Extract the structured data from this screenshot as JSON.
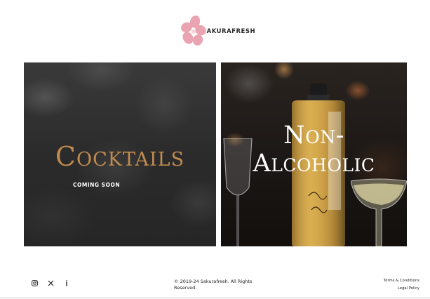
{
  "header": {
    "brand": "SAKURAFRESH",
    "brand_color": "#eaa3b0"
  },
  "panels": {
    "cocktails": {
      "title": "Cocktails",
      "subtitle": "COMING SOON",
      "title_color": "#c08b4e"
    },
    "non_alcoholic": {
      "title_line1": "Non-",
      "title_line2": "Alcoholic"
    }
  },
  "footer": {
    "social": [
      {
        "name": "instagram-icon",
        "glyph": "◎"
      },
      {
        "name": "x-icon",
        "glyph": "𝕏"
      },
      {
        "name": "info-icon",
        "glyph": "i"
      }
    ],
    "copyright": "© 2019-24 Sakurafresh. All Rights Reserved.",
    "links": {
      "terms": "Terms & Conditions",
      "legal": "Legal Policy"
    }
  }
}
